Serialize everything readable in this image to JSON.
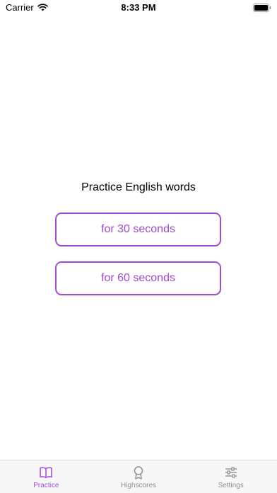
{
  "status_bar": {
    "carrier": "Carrier",
    "time": "8:33 PM"
  },
  "main": {
    "title": "Practice English words",
    "buttons": [
      {
        "label": "for 30 seconds"
      },
      {
        "label": "for 60 seconds"
      }
    ]
  },
  "tab_bar": {
    "tabs": [
      {
        "label": "Practice",
        "icon": "book-icon",
        "active": true
      },
      {
        "label": "Highscores",
        "icon": "award-icon",
        "active": false
      },
      {
        "label": "Settings",
        "icon": "sliders-icon",
        "active": false
      }
    ]
  },
  "colors": {
    "accent": "#a24cd6",
    "inactive": "#8e8e93",
    "tab_bar_bg": "#f7f7f7"
  }
}
